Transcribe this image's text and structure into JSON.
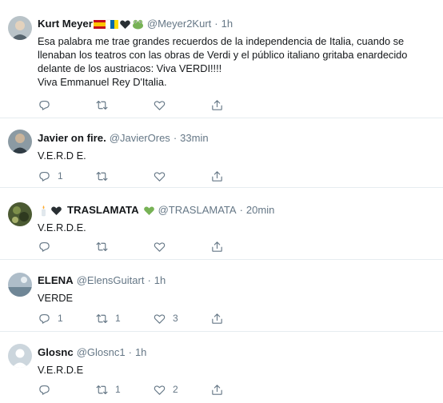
{
  "tweets": [
    {
      "name": "Kurt Meyer",
      "handle": "@Meyer2Kurt",
      "time": "1h",
      "text": "Esa palabra me trae grandes recuerdos de la independencia de Italia, cuando se llenaban los teatros con las obras de Verdi y el público italiano gritaba enardecido delante de los austriacos: Viva VERDI!!!!\nViva Emmanuel Rey D'Italia.",
      "name_emojis": [
        "spain-flag-icon",
        "canary-islands-flag-icon",
        "black-heart-icon",
        "frog-icon"
      ],
      "replies": "",
      "retweets": "",
      "likes": ""
    },
    {
      "name": "Javier on fire.",
      "handle": "@JavierOres",
      "time": "33min",
      "text": "V.E.R.D E.",
      "replies": "1",
      "retweets": "",
      "likes": ""
    },
    {
      "name": "TRASLAMATA",
      "handle": "@TRASLAMATA",
      "time": "20min",
      "text": "V.E.R.D.E.",
      "name_emojis_before": [
        "candle-icon",
        "black-heart-icon"
      ],
      "name_emojis_after": [
        "green-heart-icon"
      ],
      "replies": "",
      "retweets": "",
      "likes": ""
    },
    {
      "name": "ELENA",
      "handle": "@ElensGuitart",
      "time": "1h",
      "text": "VERDE",
      "replies": "1",
      "retweets": "1",
      "likes": "3"
    },
    {
      "name": "Glosnc",
      "handle": "@Glosnc1",
      "time": "1h",
      "text": "V.E.R.D.E",
      "replies": "",
      "retweets": "1",
      "likes": "2"
    }
  ],
  "separator": "·",
  "colors": {
    "text": "#14171a",
    "muted": "#657786",
    "divider": "#e6ecf0",
    "green_heart": "#77b255"
  }
}
